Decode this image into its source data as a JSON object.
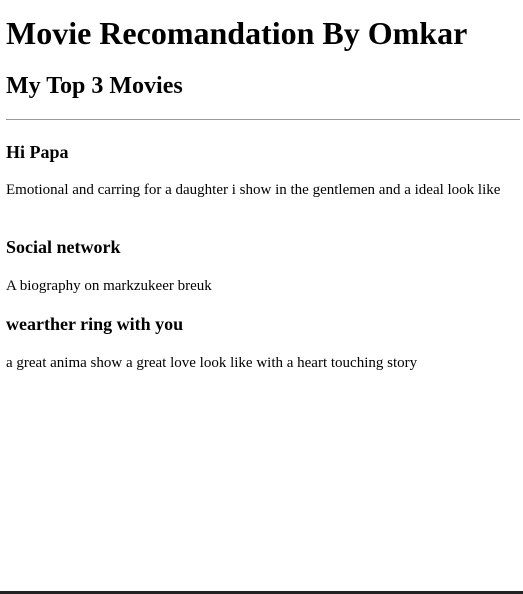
{
  "page": {
    "title": "Movie Recomandation By Omkar",
    "subtitle": "My Top 3 Movies"
  },
  "movies": [
    {
      "title": "Hi Papa",
      "description": "Emotional and carring for a daughter i show in the gentlemen and a ideal look like"
    },
    {
      "title": "Social network",
      "description": "A biography on markzukeer breuk"
    },
    {
      "title": "wearther ring with you",
      "description": "a great anima show a great love look like with a heart touching story"
    }
  ],
  "colors": {
    "text": "#000000",
    "background": "#ffffff",
    "divider": "#9a9a9a"
  }
}
